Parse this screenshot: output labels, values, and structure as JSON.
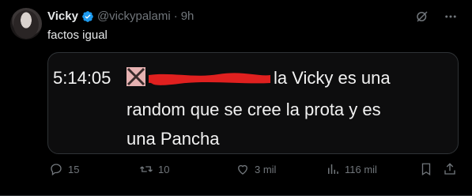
{
  "author": {
    "name": "Vicky",
    "handle": "@vickypalami",
    "separator": "·",
    "time": "9h"
  },
  "tweet": {
    "text": "factos igual"
  },
  "media": {
    "timestamp": "5:14:05",
    "line1_after_redaction": "la Vicky es una",
    "line2": "random que se cree la prota y es",
    "line3": "una Pancha"
  },
  "actions": {
    "replies": "15",
    "reposts": "10",
    "likes": "3 mil",
    "views": "116 mil"
  },
  "colors": {
    "background": "#000000",
    "text": "#e7e9ea",
    "muted": "#71767b",
    "verified": "#1d9bf0",
    "redaction": "#e0201f"
  },
  "icons": [
    "verified-badge-icon",
    "grok-icon",
    "more-icon",
    "reply-icon",
    "repost-icon",
    "like-icon",
    "views-icon",
    "bookmark-icon",
    "share-icon"
  ]
}
